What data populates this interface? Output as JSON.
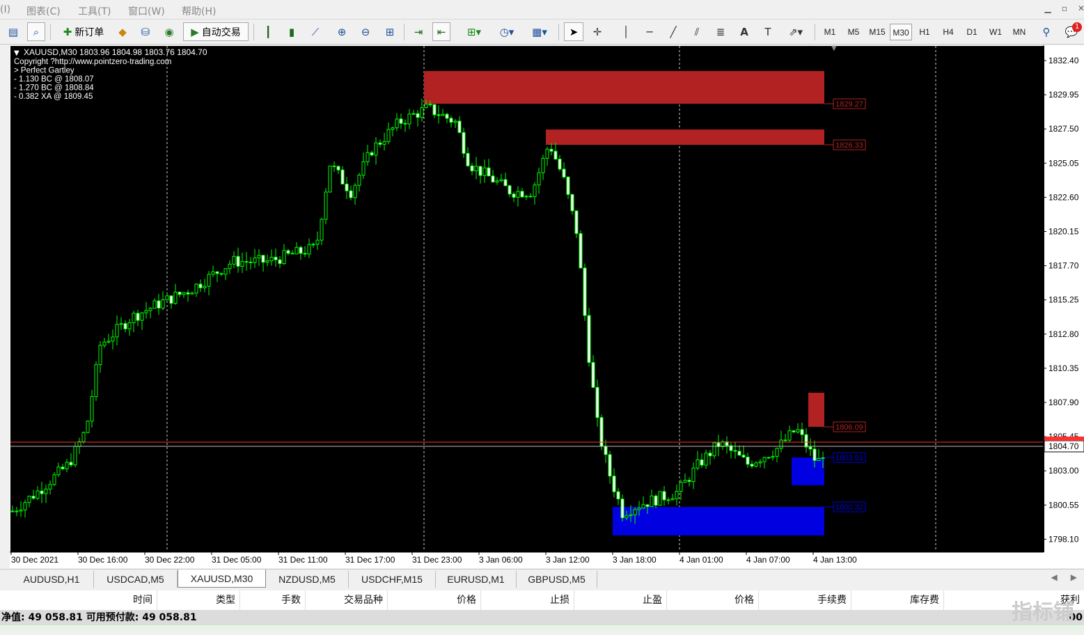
{
  "menu": {
    "items": [
      "(I)",
      "图表(C)",
      "工具(T)",
      "窗口(W)",
      "帮助(H)"
    ]
  },
  "toolbar": {
    "new_order": "新订单",
    "auto_trade": "自动交易",
    "timeframes": [
      "M1",
      "M5",
      "M15",
      "M30",
      "H1",
      "H4",
      "D1",
      "W1",
      "MN"
    ],
    "active_timeframe": "M30",
    "notification_count": "1"
  },
  "chart": {
    "header": "XAUUSD,M30  1803.96 1804.98 1803.76 1804.70",
    "info_lines": [
      "Copyright ?http://www.pointzero-trading.com",
      "> Perfect Gartley",
      "- 1.130 BC @ 1808.07",
      "- 1.270 BC @ 1808.84",
      "- 0.382 XA @ 1809.45"
    ],
    "price_labels": [
      "1832.40",
      "1829.95",
      "1827.50",
      "1825.05",
      "1822.60",
      "1820.15",
      "1817.70",
      "1815.25",
      "1812.80",
      "1810.35",
      "1807.90",
      "1805.45",
      "1803.00",
      "1800.55",
      "1798.10"
    ],
    "current_price": "1804.70",
    "time_labels": [
      "30 Dec 2021",
      "30 Dec 16:00",
      "30 Dec 22:00",
      "31 Dec 05:00",
      "31 Dec 11:00",
      "31 Dec 17:00",
      "31 Dec 23:00",
      "3 Jan 06:00",
      "3 Jan 12:00",
      "3 Jan 18:00",
      "4 Jan 01:00",
      "4 Jan 07:00",
      "4 Jan 13:00"
    ],
    "zones": [
      {
        "label": "1829.27",
        "color": "#b22222"
      },
      {
        "label": "1826.33",
        "color": "#b22222"
      },
      {
        "label": "1806.09",
        "color": "#b22222"
      },
      {
        "label": "1803.91",
        "color": "#0000e0"
      },
      {
        "label": "1800.32",
        "color": "#0000e0"
      }
    ],
    "colors": {
      "bull": "#00ff00",
      "bear": "#ffffff",
      "bid_line": "#ff3030",
      "background": "#000000"
    }
  },
  "tabs": [
    "AUDUSD,H1",
    "USDCAD,M5",
    "XAUUSD,M30",
    "NZDUSD,M5",
    "USDCHF,M15",
    "EURUSD,M1",
    "GBPUSD,M5"
  ],
  "active_tab": "XAUUSD,M30",
  "terminal": {
    "columns": [
      "时间",
      "类型",
      "手数",
      "交易品种",
      "价格",
      "止损",
      "止盈",
      "价格",
      "手续费",
      "库存费",
      "获利"
    ],
    "balance_text": "净值: 49 058.81  可用预付款: 49 058.81",
    "right_value": "00",
    "watermark": "指标铺"
  }
}
